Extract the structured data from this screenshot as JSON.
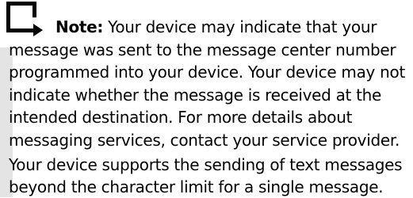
{
  "note": {
    "label": "Note:",
    "lines": [
      "Your device may indicate that your",
      "message was sent to the message center number",
      "programmed into your device. Your device may not",
      "indicate whether the message is received at the",
      "intended destination. For more details about",
      "messaging services, contact your service provider."
    ]
  },
  "body": {
    "lines": [
      "Your device supports the sending of text messages",
      "beyond the character limit for a single message."
    ]
  },
  "icons": {
    "note": "note-pointer-icon"
  },
  "colors": {
    "side_bar": "#e4e4e4",
    "text": "#000000",
    "background": "#ffffff"
  }
}
